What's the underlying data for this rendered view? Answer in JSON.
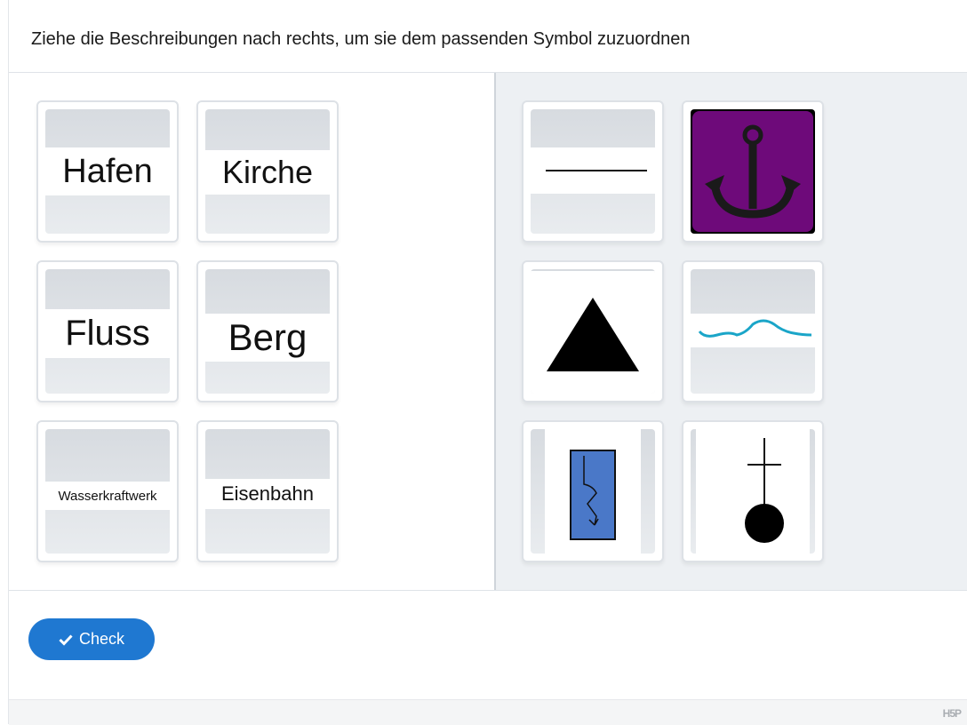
{
  "task": {
    "instruction": "Ziehe die Beschreibungen nach rechts, um sie dem passenden Symbol zuzuordnen"
  },
  "draggables": [
    {
      "label": "Hafen"
    },
    {
      "label": "Kirche"
    },
    {
      "label": "Fluss"
    },
    {
      "label": "Berg"
    },
    {
      "label": "Wasserkraftwerk"
    },
    {
      "label": "Eisenbahn"
    }
  ],
  "dropzones": [
    {
      "symbol": "railway-line-icon"
    },
    {
      "symbol": "anchor-icon"
    },
    {
      "symbol": "mountain-triangle-icon"
    },
    {
      "symbol": "river-line-icon"
    },
    {
      "symbol": "hydropower-icon"
    },
    {
      "symbol": "church-cross-icon"
    }
  ],
  "colors": {
    "primary_button": "#1f78d1",
    "anchor_background": "#6e0a7a",
    "hydropower_fill": "#4a78c8",
    "river_line": "#1aa5c8"
  },
  "actions": {
    "check_label": "Check"
  },
  "footer": {
    "logo": "H5P"
  }
}
